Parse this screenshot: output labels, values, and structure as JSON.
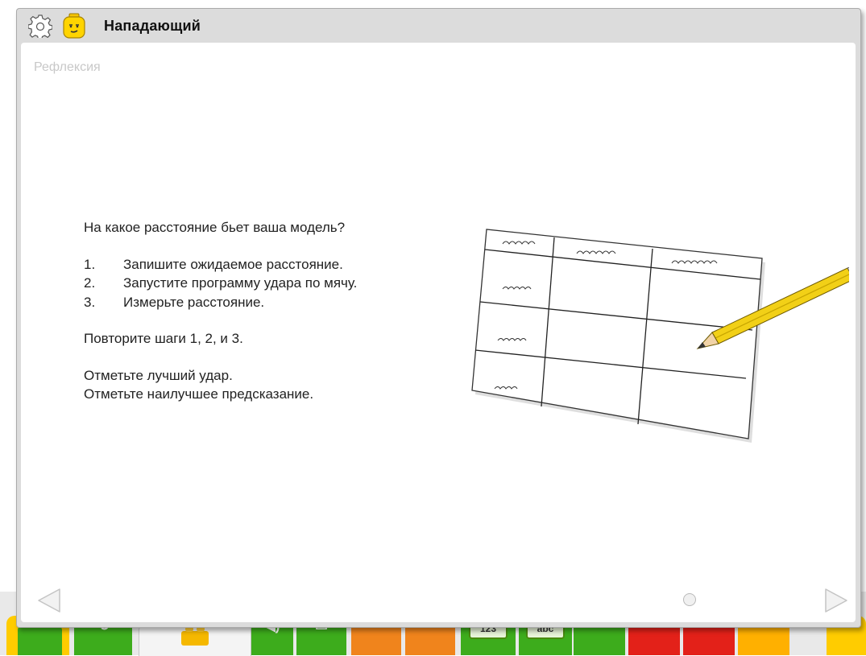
{
  "window": {
    "title": "Нападающий",
    "icons": {
      "settings": "gear-icon",
      "character": "lego-face-icon"
    }
  },
  "page": {
    "section": "Рефлексия",
    "question": "На какое расстояние бьет ваша модель?",
    "steps": [
      {
        "num": "1.",
        "text": "Запишите ожидаемое расстояние."
      },
      {
        "num": "2.",
        "text": "Запустите программу удара по мячу."
      },
      {
        "num": "3.",
        "text": "Измерьте расстояние."
      }
    ],
    "repeat": "Повторите шаги 1, 2, и 3.",
    "mark_best": "Отметьте лучший удар.",
    "mark_prediction": "Отметьте наилучшее предсказание."
  },
  "navigation": {
    "prev_icon": "triangle-left-icon",
    "next_icon": "triangle-right-icon",
    "page_indicator": "circle-dot-icon"
  },
  "palette": {
    "blocks": [
      "start-block",
      "motor-block",
      "brick-tab",
      "sound-block",
      "display-block",
      "orange-block",
      "orange-block-2",
      "number-block",
      "text-block",
      "green-block",
      "red-block",
      "red-block-2",
      "orange-yellow-block",
      "yellow-block"
    ],
    "number_label": "123",
    "text_label": "abc",
    "colors": {
      "green": "#3dac1c",
      "orange": "#f0841c",
      "red": "#e32119",
      "yellow": "#ffcc00"
    }
  }
}
